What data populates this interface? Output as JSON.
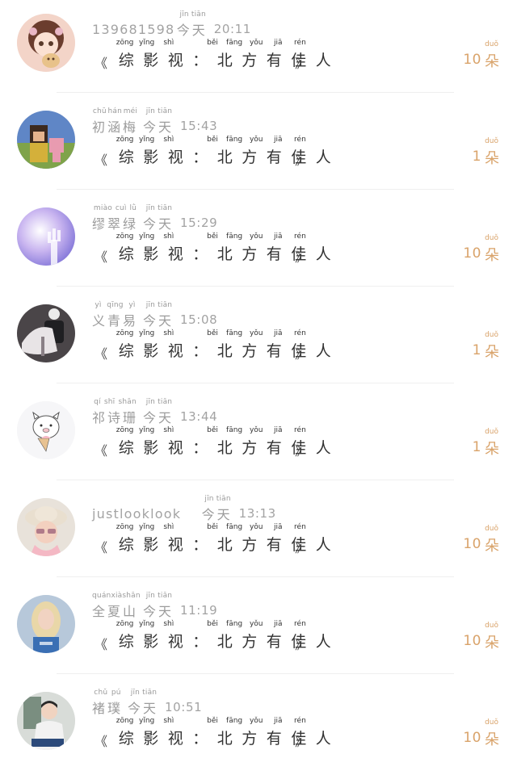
{
  "gift": {
    "open_quote": "《",
    "close_quote": "》",
    "title_chars": [
      "综",
      "影",
      "视",
      "：",
      "北",
      "方",
      "有",
      "佳",
      "人"
    ],
    "title_pinyin": [
      "zōng",
      "yǐng",
      "shì",
      "",
      "běi",
      "fāng",
      "yǒu",
      "jiā",
      "rén"
    ],
    "unit": "朵",
    "unit_pinyin": "duǒ"
  },
  "items": [
    {
      "name": "139681598",
      "name_pinyin": [],
      "time_label": "今天",
      "time_pinyin": "jīn tiān",
      "time": "20:11",
      "count": "10",
      "avatar": "cartoon-girl-avatar"
    },
    {
      "name": "初涵梅",
      "name_pinyin": [
        "chū",
        "hán",
        "méi"
      ],
      "time_label": "今天",
      "time_pinyin": "jīn tiān",
      "time": "15:43",
      "count": "1",
      "avatar": "game-character-avatar"
    },
    {
      "name": "缪翠绿",
      "name_pinyin": [
        "miào",
        "cuì",
        "lǜ"
      ],
      "time_label": "今天",
      "time_pinyin": "jīn tiān",
      "time": "15:29",
      "count": "10",
      "avatar": "moon-hand-avatar"
    },
    {
      "name": "义青易",
      "name_pinyin": [
        "yì",
        "qīng",
        "yì"
      ],
      "time_label": "今天",
      "time_pinyin": "jīn tiān",
      "time": "15:08",
      "count": "1",
      "avatar": "backpack-person-avatar"
    },
    {
      "name": "祁诗珊",
      "name_pinyin": [
        "qí",
        "shī",
        "shān"
      ],
      "time_label": "今天",
      "time_pinyin": "jīn tiān",
      "time": "13:44",
      "count": "1",
      "avatar": "cartoon-pig-avatar"
    },
    {
      "name": "justlooklook",
      "name_pinyin": [],
      "time_label": "今天",
      "time_pinyin": "jīn tiān",
      "time": "13:13",
      "count": "10",
      "avatar": "sunhat-girl-avatar"
    },
    {
      "name": "全夏山",
      "name_pinyin": [
        "quán",
        "xià",
        "shān"
      ],
      "time_label": "今天",
      "time_pinyin": "jīn tiān",
      "time": "11:19",
      "count": "10",
      "avatar": "blonde-girl-avatar"
    },
    {
      "name": "褚璞",
      "name_pinyin": [
        "chǔ",
        "pú"
      ],
      "time_label": "今天",
      "time_pinyin": "jīn tiān",
      "time": "10:51",
      "count": "10",
      "avatar": "young-man-avatar"
    }
  ]
}
